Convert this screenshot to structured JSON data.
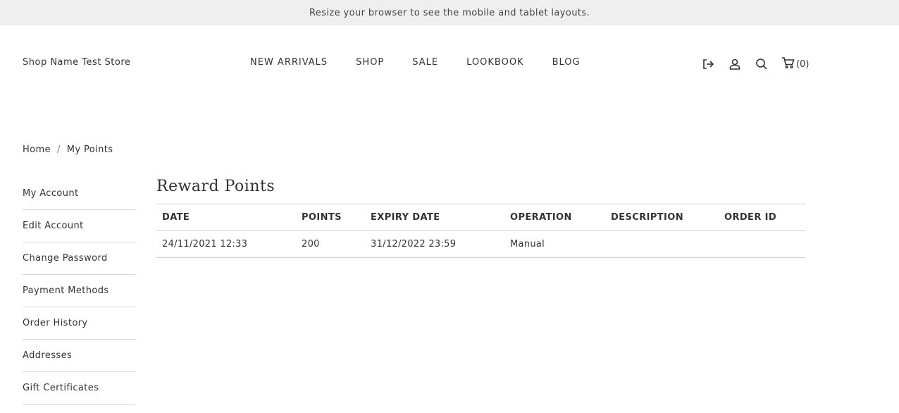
{
  "banner": {
    "text": "Resize your browser to see the mobile and tablet layouts."
  },
  "header": {
    "store_name": "Shop Name Test Store",
    "nav": [
      {
        "label": "NEW ARRIVALS"
      },
      {
        "label": "SHOP"
      },
      {
        "label": "SALE"
      },
      {
        "label": "LOOKBOOK"
      },
      {
        "label": "BLOG"
      }
    ],
    "icons": [
      "logout-icon",
      "user-icon",
      "search-icon",
      "cart-icon"
    ],
    "cart_count": "(0)"
  },
  "breadcrumb": {
    "home": "Home",
    "separator": "/",
    "current": "My Points"
  },
  "sidebar": {
    "items": [
      {
        "label": "My Account"
      },
      {
        "label": "Edit Account"
      },
      {
        "label": "Change Password"
      },
      {
        "label": "Payment Methods"
      },
      {
        "label": "Order History"
      },
      {
        "label": "Addresses"
      },
      {
        "label": "Gift Certificates"
      }
    ]
  },
  "main": {
    "title": "Reward Points",
    "table": {
      "columns": [
        "DATE",
        "POINTS",
        "EXPIRY DATE",
        "OPERATION",
        "DESCRIPTION",
        "ORDER ID"
      ],
      "rows": [
        [
          "24/11/2021 12:33",
          "200",
          "31/12/2022 23:59",
          "Manual",
          "",
          ""
        ]
      ]
    }
  },
  "colors": {
    "banner_bg": "#efefef",
    "text": "#333333",
    "divider": "#d0d0d0"
  }
}
